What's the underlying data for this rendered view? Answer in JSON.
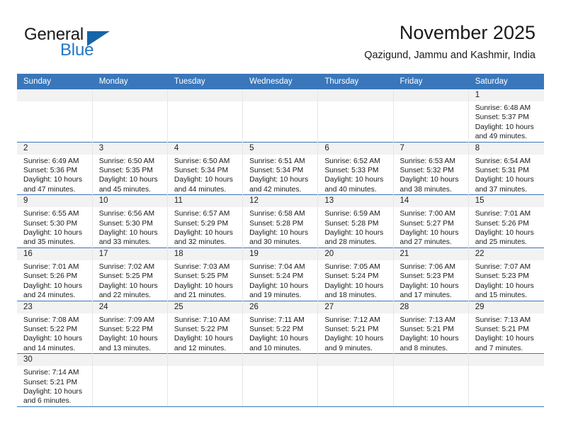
{
  "brand": {
    "name_top": "General",
    "name_bottom": "Blue",
    "accent_color": "#2077c4",
    "triangle_color": "#1565a8"
  },
  "header": {
    "title": "November 2025",
    "subtitle": "Qazigund, Jammu and Kashmir, India"
  },
  "theme": {
    "header_row_bg": "#3a77ba",
    "daynum_band_bg": "#f2f2f2",
    "grid_line": "#3a77ba",
    "column_divider": "#e6e6e6",
    "text": "#1a1a1a"
  },
  "calendar": {
    "weekday_headers": [
      "Sunday",
      "Monday",
      "Tuesday",
      "Wednesday",
      "Thursday",
      "Friday",
      "Saturday"
    ],
    "weeks": [
      [
        {
          "day": "",
          "empty": true
        },
        {
          "day": "",
          "empty": true
        },
        {
          "day": "",
          "empty": true
        },
        {
          "day": "",
          "empty": true
        },
        {
          "day": "",
          "empty": true
        },
        {
          "day": "",
          "empty": true
        },
        {
          "day": "1",
          "sunrise": "Sunrise: 6:48 AM",
          "sunset": "Sunset: 5:37 PM",
          "daylight": "Daylight: 10 hours and 49 minutes."
        }
      ],
      [
        {
          "day": "2",
          "sunrise": "Sunrise: 6:49 AM",
          "sunset": "Sunset: 5:36 PM",
          "daylight": "Daylight: 10 hours and 47 minutes."
        },
        {
          "day": "3",
          "sunrise": "Sunrise: 6:50 AM",
          "sunset": "Sunset: 5:35 PM",
          "daylight": "Daylight: 10 hours and 45 minutes."
        },
        {
          "day": "4",
          "sunrise": "Sunrise: 6:50 AM",
          "sunset": "Sunset: 5:34 PM",
          "daylight": "Daylight: 10 hours and 44 minutes."
        },
        {
          "day": "5",
          "sunrise": "Sunrise: 6:51 AM",
          "sunset": "Sunset: 5:34 PM",
          "daylight": "Daylight: 10 hours and 42 minutes."
        },
        {
          "day": "6",
          "sunrise": "Sunrise: 6:52 AM",
          "sunset": "Sunset: 5:33 PM",
          "daylight": "Daylight: 10 hours and 40 minutes."
        },
        {
          "day": "7",
          "sunrise": "Sunrise: 6:53 AM",
          "sunset": "Sunset: 5:32 PM",
          "daylight": "Daylight: 10 hours and 38 minutes."
        },
        {
          "day": "8",
          "sunrise": "Sunrise: 6:54 AM",
          "sunset": "Sunset: 5:31 PM",
          "daylight": "Daylight: 10 hours and 37 minutes."
        }
      ],
      [
        {
          "day": "9",
          "sunrise": "Sunrise: 6:55 AM",
          "sunset": "Sunset: 5:30 PM",
          "daylight": "Daylight: 10 hours and 35 minutes."
        },
        {
          "day": "10",
          "sunrise": "Sunrise: 6:56 AM",
          "sunset": "Sunset: 5:30 PM",
          "daylight": "Daylight: 10 hours and 33 minutes."
        },
        {
          "day": "11",
          "sunrise": "Sunrise: 6:57 AM",
          "sunset": "Sunset: 5:29 PM",
          "daylight": "Daylight: 10 hours and 32 minutes."
        },
        {
          "day": "12",
          "sunrise": "Sunrise: 6:58 AM",
          "sunset": "Sunset: 5:28 PM",
          "daylight": "Daylight: 10 hours and 30 minutes."
        },
        {
          "day": "13",
          "sunrise": "Sunrise: 6:59 AM",
          "sunset": "Sunset: 5:28 PM",
          "daylight": "Daylight: 10 hours and 28 minutes."
        },
        {
          "day": "14",
          "sunrise": "Sunrise: 7:00 AM",
          "sunset": "Sunset: 5:27 PM",
          "daylight": "Daylight: 10 hours and 27 minutes."
        },
        {
          "day": "15",
          "sunrise": "Sunrise: 7:01 AM",
          "sunset": "Sunset: 5:26 PM",
          "daylight": "Daylight: 10 hours and 25 minutes."
        }
      ],
      [
        {
          "day": "16",
          "sunrise": "Sunrise: 7:01 AM",
          "sunset": "Sunset: 5:26 PM",
          "daylight": "Daylight: 10 hours and 24 minutes."
        },
        {
          "day": "17",
          "sunrise": "Sunrise: 7:02 AM",
          "sunset": "Sunset: 5:25 PM",
          "daylight": "Daylight: 10 hours and 22 minutes."
        },
        {
          "day": "18",
          "sunrise": "Sunrise: 7:03 AM",
          "sunset": "Sunset: 5:25 PM",
          "daylight": "Daylight: 10 hours and 21 minutes."
        },
        {
          "day": "19",
          "sunrise": "Sunrise: 7:04 AM",
          "sunset": "Sunset: 5:24 PM",
          "daylight": "Daylight: 10 hours and 19 minutes."
        },
        {
          "day": "20",
          "sunrise": "Sunrise: 7:05 AM",
          "sunset": "Sunset: 5:24 PM",
          "daylight": "Daylight: 10 hours and 18 minutes."
        },
        {
          "day": "21",
          "sunrise": "Sunrise: 7:06 AM",
          "sunset": "Sunset: 5:23 PM",
          "daylight": "Daylight: 10 hours and 17 minutes."
        },
        {
          "day": "22",
          "sunrise": "Sunrise: 7:07 AM",
          "sunset": "Sunset: 5:23 PM",
          "daylight": "Daylight: 10 hours and 15 minutes."
        }
      ],
      [
        {
          "day": "23",
          "sunrise": "Sunrise: 7:08 AM",
          "sunset": "Sunset: 5:22 PM",
          "daylight": "Daylight: 10 hours and 14 minutes."
        },
        {
          "day": "24",
          "sunrise": "Sunrise: 7:09 AM",
          "sunset": "Sunset: 5:22 PM",
          "daylight": "Daylight: 10 hours and 13 minutes."
        },
        {
          "day": "25",
          "sunrise": "Sunrise: 7:10 AM",
          "sunset": "Sunset: 5:22 PM",
          "daylight": "Daylight: 10 hours and 12 minutes."
        },
        {
          "day": "26",
          "sunrise": "Sunrise: 7:11 AM",
          "sunset": "Sunset: 5:22 PM",
          "daylight": "Daylight: 10 hours and 10 minutes."
        },
        {
          "day": "27",
          "sunrise": "Sunrise: 7:12 AM",
          "sunset": "Sunset: 5:21 PM",
          "daylight": "Daylight: 10 hours and 9 minutes."
        },
        {
          "day": "28",
          "sunrise": "Sunrise: 7:13 AM",
          "sunset": "Sunset: 5:21 PM",
          "daylight": "Daylight: 10 hours and 8 minutes."
        },
        {
          "day": "29",
          "sunrise": "Sunrise: 7:13 AM",
          "sunset": "Sunset: 5:21 PM",
          "daylight": "Daylight: 10 hours and 7 minutes."
        }
      ],
      [
        {
          "day": "30",
          "sunrise": "Sunrise: 7:14 AM",
          "sunset": "Sunset: 5:21 PM",
          "daylight": "Daylight: 10 hours and 6 minutes."
        },
        {
          "day": "",
          "empty": true
        },
        {
          "day": "",
          "empty": true
        },
        {
          "day": "",
          "empty": true
        },
        {
          "day": "",
          "empty": true
        },
        {
          "day": "",
          "empty": true
        },
        {
          "day": "",
          "empty": true
        }
      ]
    ]
  }
}
